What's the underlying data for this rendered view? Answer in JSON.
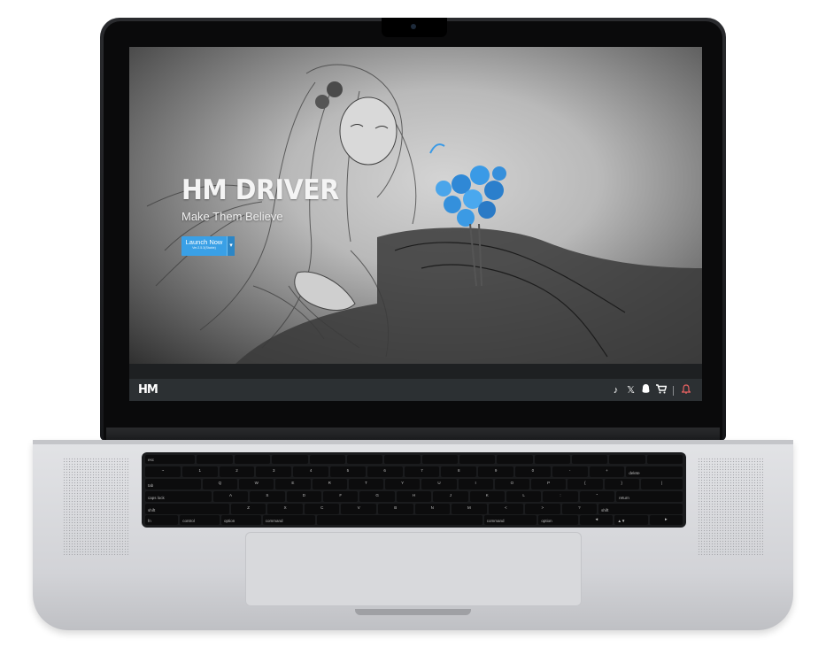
{
  "hero": {
    "title": "HM DRIVER",
    "tagline": "Make Them Believe",
    "launch_button": {
      "label": "Launch Now",
      "version": "Ver.2.5.3(Stable)",
      "dropdown_icon": "chevron-down-icon"
    }
  },
  "bottombar": {
    "logo": "HM",
    "icons": [
      "tiktok-icon",
      "x-icon",
      "qq-icon",
      "cart-icon",
      "bell-icon"
    ]
  },
  "colors": {
    "accent": "#3aa0e6",
    "bar": "#2c3033",
    "bell": "#e86262"
  },
  "keyboard": {
    "rows": [
      [
        "esc",
        "",
        "",
        "",
        "",
        "",
        "",
        "",
        "",
        "",
        "",
        "",
        "",
        ""
      ],
      [
        "~",
        "1",
        "2",
        "3",
        "4",
        "5",
        "6",
        "7",
        "8",
        "9",
        "0",
        "-",
        "+",
        "delete"
      ],
      [
        "tab",
        "Q",
        "W",
        "E",
        "R",
        "T",
        "Y",
        "U",
        "I",
        "O",
        "P",
        "{",
        "}",
        "|"
      ],
      [
        "caps lock",
        "A",
        "S",
        "D",
        "F",
        "G",
        "H",
        "J",
        "K",
        "L",
        ":",
        "\"",
        "return"
      ],
      [
        "shift",
        "Z",
        "X",
        "C",
        "V",
        "B",
        "N",
        "M",
        "<",
        ">",
        "?",
        "shift"
      ],
      [
        "fn",
        "control",
        "option",
        "command",
        "",
        "command",
        "option",
        "◄",
        "▲▼",
        "►"
      ]
    ]
  }
}
